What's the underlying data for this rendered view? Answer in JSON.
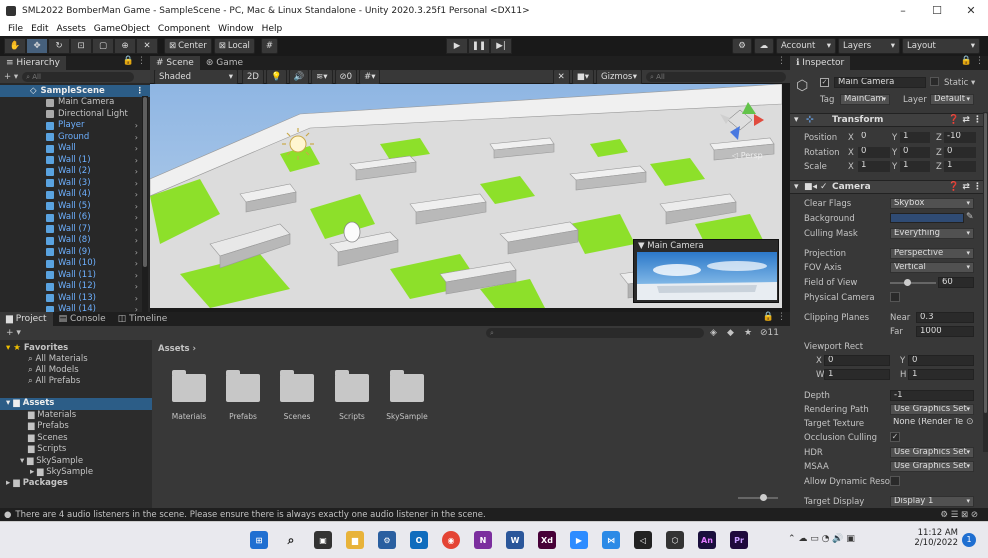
{
  "window": {
    "title": "SML2022 BomberMan Game - SampleScene - PC, Mac & Linux Standalone - Unity 2020.3.25f1 Personal <DX11>",
    "min": "–",
    "max": "☐",
    "close": "✕"
  },
  "menu": [
    "File",
    "Edit",
    "Assets",
    "GameObject",
    "Component",
    "Window",
    "Help"
  ],
  "toolbar": {
    "center": "Center",
    "local": "Local",
    "account": "Account",
    "layers": "Layers",
    "layout": "Layout"
  },
  "hierarchy": {
    "tab": "Hierarchy",
    "search_placeholder": "All",
    "scene": "SampleScene",
    "items": [
      {
        "label": "Main Camera",
        "color": "white",
        "arrow": false
      },
      {
        "label": "Directional Light",
        "color": "white",
        "arrow": false
      },
      {
        "label": "Player",
        "color": "blue",
        "arrow": true
      },
      {
        "label": "Ground",
        "color": "blue",
        "arrow": true
      },
      {
        "label": "Wall",
        "color": "blue",
        "arrow": true
      },
      {
        "label": "Wall (1)",
        "color": "blue",
        "arrow": true
      },
      {
        "label": "Wall (2)",
        "color": "blue",
        "arrow": true
      },
      {
        "label": "Wall (3)",
        "color": "blue",
        "arrow": true
      },
      {
        "label": "Wall (4)",
        "color": "blue",
        "arrow": true
      },
      {
        "label": "Wall (5)",
        "color": "blue",
        "arrow": true
      },
      {
        "label": "Wall (6)",
        "color": "blue",
        "arrow": true
      },
      {
        "label": "Wall (7)",
        "color": "blue",
        "arrow": true
      },
      {
        "label": "Wall (8)",
        "color": "blue",
        "arrow": true
      },
      {
        "label": "Wall (9)",
        "color": "blue",
        "arrow": true
      },
      {
        "label": "Wall (10)",
        "color": "blue",
        "arrow": true
      },
      {
        "label": "Wall (11)",
        "color": "blue",
        "arrow": true
      },
      {
        "label": "Wall (12)",
        "color": "blue",
        "arrow": true
      },
      {
        "label": "Wall (13)",
        "color": "blue",
        "arrow": true
      },
      {
        "label": "Wall (14)",
        "color": "blue",
        "arrow": true
      }
    ]
  },
  "scene": {
    "tab_scene": "Scene",
    "tab_game": "Game",
    "shading": "Shaded",
    "mode_2d": "2D",
    "hidden_count": "0",
    "gizmos": "Gizmos",
    "search_placeholder": "All",
    "persp": "◁ Persp",
    "camera_preview_title": "Main Camera"
  },
  "project": {
    "tab_project": "Project",
    "tab_console": "Console",
    "tab_timeline": "Timeline",
    "count": "11",
    "favorites": "Favorites",
    "fav_items": [
      "All Materials",
      "All Models",
      "All Prefabs"
    ],
    "assets_root": "Assets",
    "asset_tree": [
      "Materials",
      "Prefabs",
      "Scenes",
      "Scripts"
    ],
    "skysample_parent": "SkySample",
    "skysample_child": "SkySample",
    "packages": "Packages",
    "breadcrumb": "Assets",
    "folders": [
      "Materials",
      "Prefabs",
      "Scenes",
      "Scripts",
      "SkySample"
    ]
  },
  "inspector": {
    "tab": "Inspector",
    "object_name": "Main Camera",
    "static": "Static",
    "tag_label": "Tag",
    "tag": "MainCam",
    "layer_label": "Layer",
    "layer": "Default",
    "transform": "Transform",
    "position_label": "Position",
    "rotation_label": "Rotation",
    "scale_label": "Scale",
    "position": {
      "x": "0",
      "y": "1",
      "z": "-10"
    },
    "rotation": {
      "x": "0",
      "y": "0",
      "z": "0"
    },
    "scale": {
      "x": "1",
      "y": "1",
      "z": "1"
    },
    "camera": "Camera",
    "clear_flags_label": "Clear Flags",
    "clear_flags": "Skybox",
    "background_label": "Background",
    "background_color": "#2f4b74",
    "culling_mask_label": "Culling Mask",
    "culling_mask": "Everything",
    "projection_label": "Projection",
    "projection": "Perspective",
    "fov_axis_label": "FOV Axis",
    "fov_axis": "Vertical",
    "fov_label": "Field of View",
    "fov": "60",
    "physical_label": "Physical Camera",
    "clipping_label": "Clipping Planes",
    "near_label": "Near",
    "near": "0.3",
    "far_label": "Far",
    "far": "1000",
    "viewport_label": "Viewport Rect",
    "vx": "0",
    "vy": "0",
    "vw": "1",
    "vh": "1",
    "depth_label": "Depth",
    "depth": "-1",
    "render_path_label": "Rendering Path",
    "render_path": "Use Graphics Set",
    "target_texture_label": "Target Texture",
    "target_texture": "None (Render Te",
    "occlusion_label": "Occlusion Culling",
    "hdr_label": "HDR",
    "hdr": "Use Graphics Set",
    "msaa_label": "MSAA",
    "msaa": "Use Graphics Set",
    "dynres_label": "Allow Dynamic Resol",
    "target_display_label": "Target Display",
    "target_display": "Display 1"
  },
  "status": {
    "message": "There are 4 audio listeners in the scene. Please ensure there is always exactly one audio listener in the scene."
  },
  "taskbar": {
    "time": "11:12 AM",
    "date": "2/10/2022",
    "badge": "1"
  }
}
